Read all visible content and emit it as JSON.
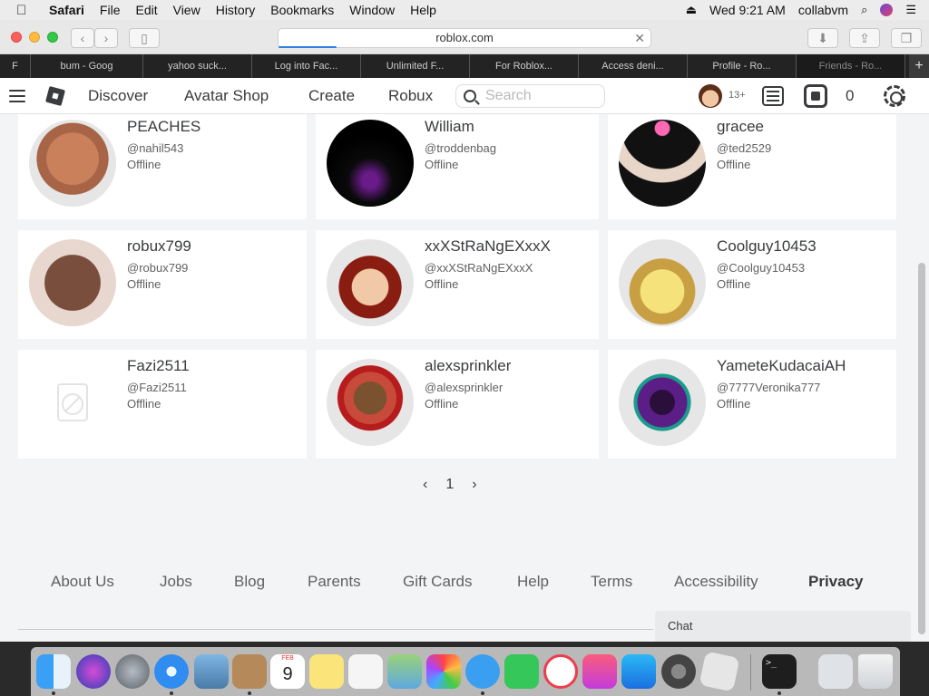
{
  "menubar": {
    "app": "Safari",
    "items": [
      "File",
      "Edit",
      "View",
      "History",
      "Bookmarks",
      "Window",
      "Help"
    ],
    "clock": "Wed 9:21 AM",
    "user": "collabvm"
  },
  "browser": {
    "url": "roblox.com",
    "tabs": [
      "F",
      "bum - Goog",
      "yahoo suck...",
      "Log into Fac...",
      "Unlimited F...",
      "For Roblox...",
      "Access deni...",
      "Profile - Ro...",
      "Friends - Ro..."
    ],
    "new_tab": "+"
  },
  "roblox_nav": {
    "links": [
      "Discover",
      "Avatar Shop",
      "Create",
      "Robux"
    ],
    "search_placeholder": "Search",
    "age_label": "13+",
    "robux_count": "0"
  },
  "friends": [
    {
      "name": "PEACHES",
      "handle": "@nahil543",
      "status": "Offline"
    },
    {
      "name": "William",
      "handle": "@troddenbag",
      "status": "Offline"
    },
    {
      "name": "gracee",
      "handle": "@ted2529",
      "status": "Offline"
    },
    {
      "name": "robux799",
      "handle": "@robux799",
      "status": "Offline"
    },
    {
      "name": "xxXStRaNgEXxxX",
      "handle": "@xxXStRaNgEXxxX",
      "status": "Offline"
    },
    {
      "name": "Coolguy10453",
      "handle": "@Coolguy10453",
      "status": "Offline"
    },
    {
      "name": "Fazi2511",
      "handle": "@Fazi2511",
      "status": "Offline"
    },
    {
      "name": "alexsprinkler",
      "handle": "@alexsprinkler",
      "status": "Offline"
    },
    {
      "name": "YameteKudacaiAH",
      "handle": "@7777Veronika777",
      "status": "Offline"
    }
  ],
  "pager": {
    "prev": "‹",
    "page": "1",
    "next": "›"
  },
  "footer": {
    "links": [
      "About Us",
      "Jobs",
      "Blog",
      "Parents",
      "Gift Cards",
      "Help",
      "Terms",
      "Accessibility",
      "Privacy"
    ]
  },
  "chat_label": "Chat",
  "dock": {
    "calendar_month": "FEB",
    "calendar_day": "9"
  }
}
